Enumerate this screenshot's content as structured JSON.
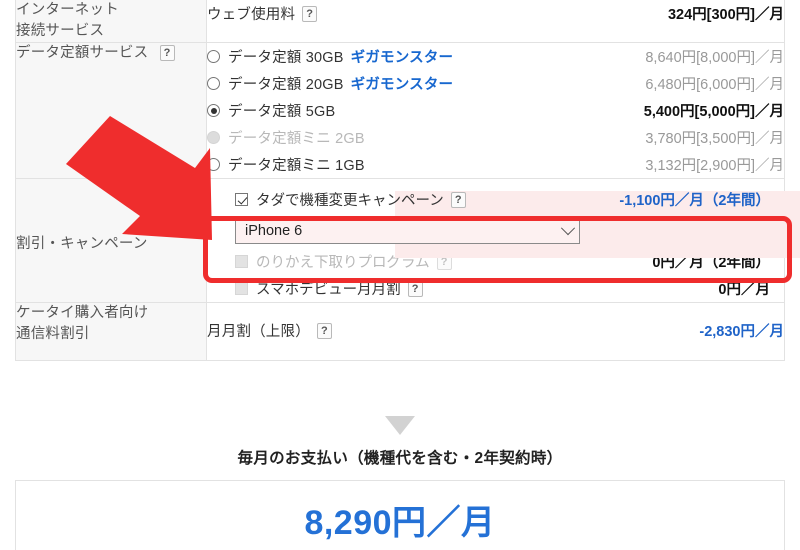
{
  "table": {
    "rows": [
      {
        "header": "インターネット\n接続サービス",
        "header_line1": "インターネット",
        "header_line2": "接続サービス",
        "header_help": false,
        "items": [
          {
            "label": "ウェブ使用料",
            "help": "?",
            "price": "324円[300円]／月",
            "price_style": "strong",
            "control": "none"
          }
        ]
      },
      {
        "header_line1": "データ定額サービス",
        "header_line2": "",
        "header_help": "?",
        "items": [
          {
            "label": "データ定額 30GB",
            "tag": "ギガモンスター",
            "price": "8,640円[8,000円]／月",
            "price_style": "mute",
            "control": "radio",
            "checked": false,
            "disabled": false
          },
          {
            "label": "データ定額 20GB",
            "tag": "ギガモンスター",
            "price": "6,480円[6,000円]／月",
            "price_style": "mute",
            "control": "radio",
            "checked": false,
            "disabled": false
          },
          {
            "label": "データ定額 5GB",
            "tag": "",
            "price": "5,400円[5,000円]／月",
            "price_style": "strong",
            "control": "radio",
            "checked": true,
            "disabled": false
          },
          {
            "label": "データ定額ミニ 2GB",
            "tag": "",
            "price": "3,780円[3,500円]／月",
            "price_style": "mute",
            "control": "radio",
            "checked": false,
            "disabled": true
          },
          {
            "label": "データ定額ミニ 1GB",
            "tag": "",
            "price": "3,132円[2,900円]／月",
            "price_style": "mute",
            "control": "radio",
            "checked": false,
            "disabled": false
          }
        ]
      },
      {
        "header_line1": "割引・キャンペーン",
        "header_line2": "",
        "header_help": false,
        "items": [
          {
            "label": "タダで機種変更キャンペーン",
            "help": "?",
            "price": "-1,100円／月（2年間）",
            "price_style": "blue",
            "control": "checkbox",
            "checked": true,
            "disabled": false,
            "highlighted": true
          },
          {
            "label": "のりかえ下取りプログラム",
            "help": "?",
            "price": "0円／月（2年間）",
            "price_style": "strong",
            "control": "checkbox",
            "checked": false,
            "disabled": true
          },
          {
            "label": "スマホデビュー月月割",
            "help": "?",
            "price": "0円／月",
            "price_style": "strong",
            "control": "checkbox",
            "checked": false,
            "disabled": true
          }
        ],
        "device_select": {
          "value": "iPhone 6",
          "chevron": "chevron-down-icon"
        }
      },
      {
        "header_line1": "ケータイ購入者向け",
        "header_line2": "通信料割引",
        "header_help": false,
        "items": [
          {
            "label": "月月割（上限）",
            "help": "?",
            "price": "-2,830円／月",
            "price_style": "blue",
            "control": "none"
          }
        ]
      }
    ]
  },
  "summary": {
    "arrow_icon": "triangle-down-icon",
    "title": "毎月のお支払い（機種代を含む・2年契約時）",
    "amount": "8,290円／月"
  },
  "annotations": {
    "arrow_icon": "red-arrow-annotation",
    "highlight_box": "red-highlight-box"
  },
  "colors": {
    "accent_blue": "#1f63c8",
    "tag_blue": "#1767cf",
    "annotation_red": "#ef2d2d",
    "highlight_pink": "#fcebeb",
    "total_blue": "#2471d6"
  }
}
